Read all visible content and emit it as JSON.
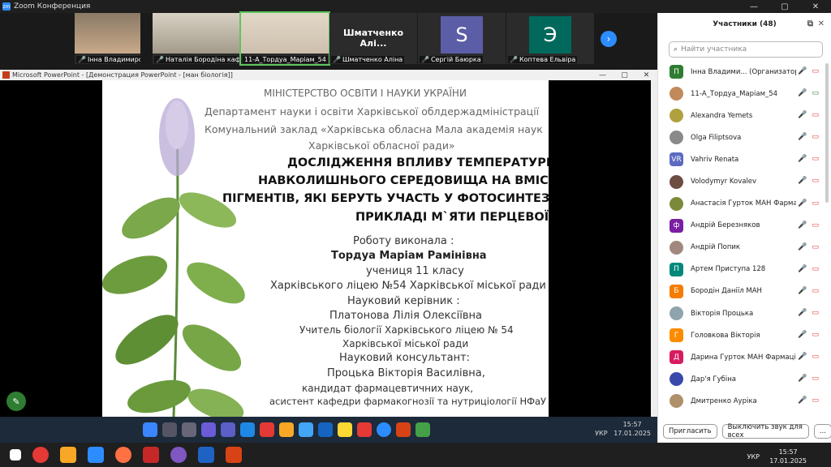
{
  "zoom": {
    "title": "Zoom Конференция",
    "logo": "zm"
  },
  "window_controls": {
    "minimize": "—",
    "maximize": "▢",
    "close": "✕"
  },
  "tiles": [
    {
      "name": "Інна Владимирова",
      "muted": true
    },
    {
      "name": "Наталія Бородіна каф...",
      "muted": true
    },
    {
      "name": "11-А_Тордуа_Маріам_54",
      "muted": false
    },
    {
      "name": "Шматченко Аліна",
      "muted": true,
      "big": "Шматченко Алі..."
    },
    {
      "name": "Сергій Баюрка",
      "muted": true,
      "letter": "S",
      "color": "#5b5ea6"
    },
    {
      "name": "Коптева Ельвіра",
      "muted": true,
      "letter": "Э",
      "color": "#00695c"
    }
  ],
  "ppt": {
    "title": "Microsoft PowerPoint - [Демонстрация PowerPoint - [ман біологія]]"
  },
  "slide": {
    "l1": "МІНІСТЕРСТВО ОСВІТИ І НАУКИ УКРАЇНИ",
    "l2": "Департамент науки і освіти Харківської облдержадміністрації",
    "l3": "Комунальний заклад «Харківська обласна Мала академія наук",
    "l4": "Харківської обласної ради»",
    "t1": "ДОСЛІДЖЕННЯ ВПЛИВУ ТЕМПЕРАТУРИ",
    "t2": "НАВКОЛИШНЬОГО СЕРЕДОВИЩА НА ВМІСТ",
    "t3": "ПІГМЕНТІВ, ЯКІ БЕРУТЬ УЧАСТЬ У ФОТОСИНТЕЗІ, НА",
    "t4": "ПРИКЛАДІ М`ЯТИ ПЕРЦЕВОЇ",
    "a1": "Роботу виконала :",
    "a2": "Тордуа Маріам Рамінівна",
    "a3": "учениця 11 класу",
    "a4": "Харківського ліцею №54 Харківської міської ради",
    "s1": "Науковий керівник :",
    "s2": "Платонова Лілія Олексіївна",
    "s3": "Учитель біології  Харківського ліцею № 54",
    "s4": "Харківської міської ради",
    "c1": "Науковий консультант:",
    "c2": "Процька Вікторія Василівна,",
    "c3": "кандидат фармацевтичних  наук,",
    "c4": "асистент кафедри фармакогнозії та нутриціології  НФаУ"
  },
  "inner_tray": {
    "lang": "УКР",
    "time": "15:57",
    "date": "17.01.2025"
  },
  "participants": {
    "header": "Участники (48)",
    "search_placeholder": "Найти участника",
    "items": [
      {
        "name": "Інна Владими... (Организатор, я)",
        "letter": "П",
        "color": "#2e7d32"
      },
      {
        "name": "11-А_Тордуа_Маріам_54",
        "letter": "",
        "color": "#c08a5b"
      },
      {
        "name": "Alexandra Yemets",
        "letter": "",
        "color": "#b0a040"
      },
      {
        "name": "Olga Filiptsova",
        "letter": "",
        "color": "#8a8a8a"
      },
      {
        "name": "Vahriv Renata",
        "letter": "VR",
        "color": "#5c6bc0"
      },
      {
        "name": "Volodymyr Kovalev",
        "letter": "",
        "color": "#6d4c41"
      },
      {
        "name": "Анастасія Гурток МАН Фармація",
        "letter": "",
        "color": "#7b8a3a"
      },
      {
        "name": "Андрій Березняков",
        "letter": "ф",
        "color": "#7b1fa2"
      },
      {
        "name": "Андрій Попик",
        "letter": "",
        "color": "#a1887f"
      },
      {
        "name": "Артем Приступа 128",
        "letter": "П",
        "color": "#00897b"
      },
      {
        "name": "Бородін Даніїл МАН",
        "letter": "Б",
        "color": "#f57c00"
      },
      {
        "name": "Вікторія Процька",
        "letter": "",
        "color": "#90a4ae"
      },
      {
        "name": "Головкова Вікторія",
        "letter": "Г",
        "color": "#fb8c00"
      },
      {
        "name": "Дарина Гурток МАН Фармація",
        "letter": "Д",
        "color": "#d81b60"
      },
      {
        "name": "Дар'я Губіна",
        "letter": "",
        "color": "#3949ab"
      },
      {
        "name": "Дмитренко Аурiка",
        "letter": "",
        "color": "#b0906a"
      }
    ],
    "invite": "Пригласить",
    "mute_all": "Выключить звук для всех",
    "more": "..."
  },
  "taskbar": {
    "lang": "УКР",
    "time": "15:57",
    "date": "17.01.2025"
  }
}
